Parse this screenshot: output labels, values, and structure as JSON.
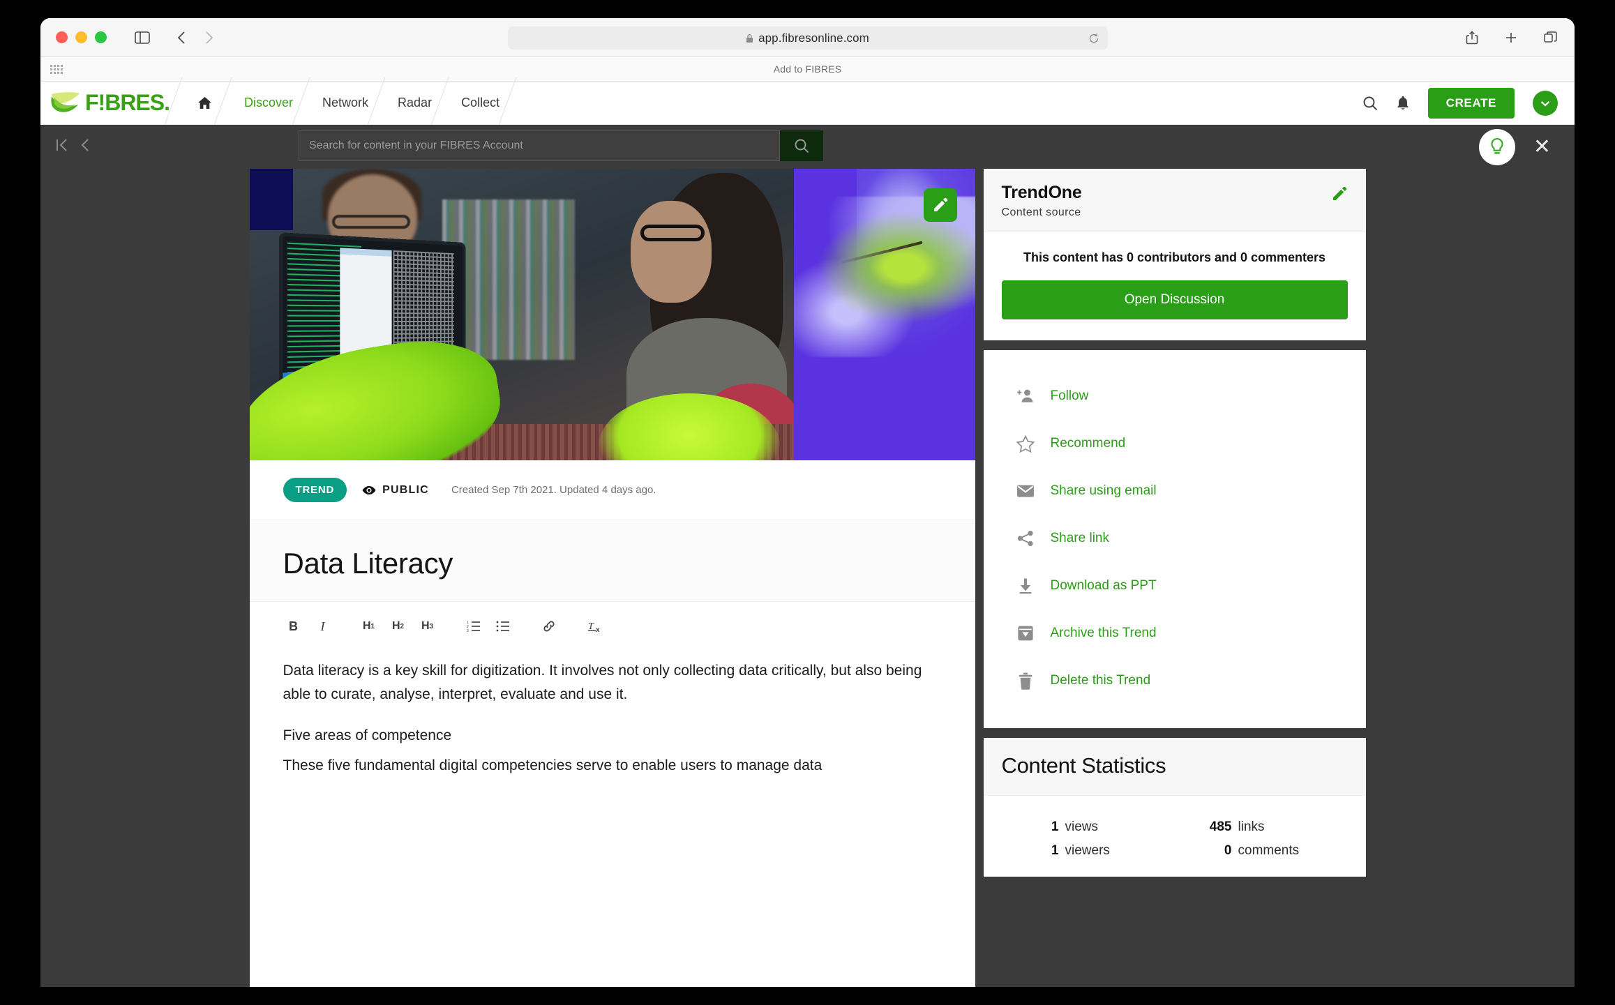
{
  "browser": {
    "url": "app.fibresonline.com",
    "bookmark_label": "Add to FIBRES"
  },
  "app_nav": {
    "logo_text": "F!BRES.",
    "items": [
      {
        "label": "Discover",
        "active": true
      },
      {
        "label": "Network",
        "active": false
      },
      {
        "label": "Radar",
        "active": false
      },
      {
        "label": "Collect",
        "active": false
      }
    ],
    "create_label": "CREATE"
  },
  "overlay": {
    "search_placeholder": "Search for content in your FIBRES Account"
  },
  "content": {
    "badge": "TREND",
    "visibility": "PUBLIC",
    "timestamps": "Created Sep 7th 2021. Updated 4 days ago.",
    "title": "Data Literacy",
    "toolbar": {
      "bold": "B",
      "italic": "I",
      "h1": "H",
      "h1_sub": "1",
      "h2": "H",
      "h2_sub": "2",
      "h3": "H",
      "h3_sub": "3"
    },
    "paragraph_1": "Data literacy is a key skill for digitization. It involves not only collecting data critically, but also being able to curate, analyse, interpret, evaluate and use it.",
    "heading_1": "Five areas of competence",
    "paragraph_2": "These five fundamental digital competencies serve to enable users to manage data"
  },
  "source_panel": {
    "title": "TrendOne",
    "subtitle": "Content source",
    "contributors_line": "This content has 0 contributors and 0 commenters",
    "discussion_button": "Open Discussion"
  },
  "actions": [
    {
      "label": "Follow",
      "icon": "person-add-icon"
    },
    {
      "label": "Recommend",
      "icon": "star-icon"
    },
    {
      "label": "Share using email",
      "icon": "envelope-icon"
    },
    {
      "label": "Share link",
      "icon": "share-icon"
    },
    {
      "label": "Download as PPT",
      "icon": "download-icon"
    },
    {
      "label": "Archive this Trend",
      "icon": "archive-icon"
    },
    {
      "label": "Delete this Trend",
      "icon": "trash-icon"
    }
  ],
  "statistics": {
    "title": "Content Statistics",
    "items": [
      {
        "num": "1",
        "label": "views"
      },
      {
        "num": "485",
        "label": "links"
      },
      {
        "num": "1",
        "label": "viewers"
      },
      {
        "num": "0",
        "label": "comments"
      }
    ]
  },
  "colors": {
    "brand_green": "#2a9e17",
    "logo_green": "#3aa017",
    "badge_teal": "#0a9e85",
    "overlay_dark": "#3b3b3b"
  }
}
